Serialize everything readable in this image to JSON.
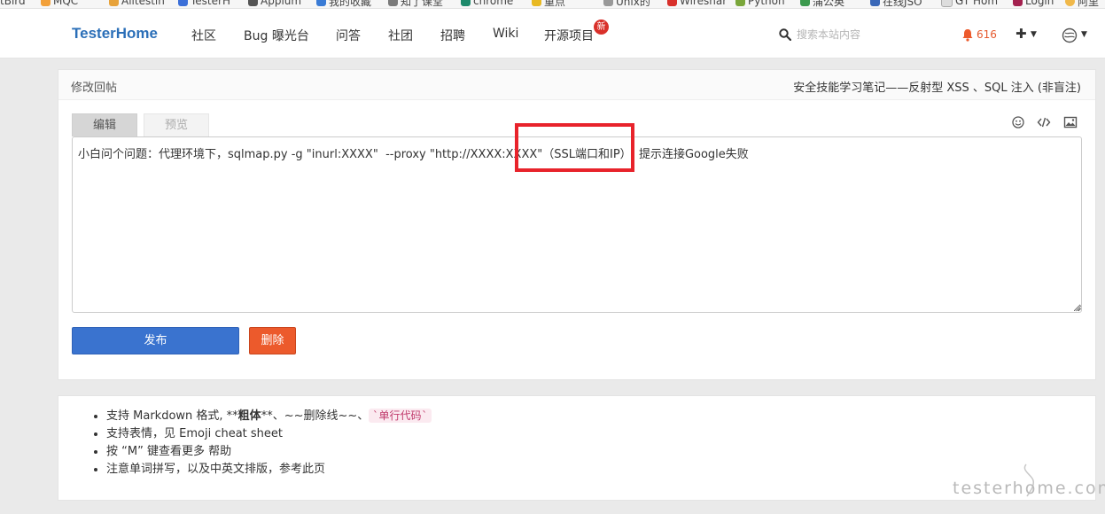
{
  "bookmarks": [
    "tBird",
    "MQC",
    "Alitestin",
    "TesterH",
    "Appium",
    "我的收藏",
    "知了课堂",
    "chrome",
    "重点",
    "Unix的",
    "Wireshar",
    "Python",
    "蒲公英",
    "在线JSO",
    "GT Hom",
    "Login",
    "阿里"
  ],
  "navbar": {
    "brand": "TesterHome",
    "items": [
      "社区",
      "Bug 曝光台",
      "问答",
      "社团",
      "招聘",
      "Wiki",
      "开源项目"
    ],
    "new_badge": "新",
    "search_placeholder": "搜索本站内容",
    "notification_count": "616"
  },
  "panel": {
    "title": "修改回帖",
    "topic_title": "安全技能学习笔记——反射型 XSS 、SQL 注入 (非盲注)",
    "tabs": [
      "编辑",
      "预览"
    ],
    "editor_text": "小白问个问题：代理环境下，sqlmap.py -g \"inurl:XXXX\"  --proxy \"http://XXXX:XXXX\"（SSL端口和IP）  提示连接Google失败",
    "publish_label": "发布",
    "delete_label": "删除"
  },
  "help": {
    "items": [
      {
        "before": "支持 Markdown 格式, **",
        "bold": "粗体",
        "after": "**、~~删除线~~、",
        "code": "`单行代码`"
      },
      {
        "text": "支持表情，见 Emoji cheat sheet"
      },
      {
        "text": "按 “M” 键查看更多 帮助"
      },
      {
        "text": "注意单词拼写，以及中英文排版，参考此页"
      }
    ]
  },
  "watermark": "testerhome.com",
  "colors": {
    "brand": "#2b6fb8",
    "publish": "#3a73cf",
    "delete": "#ec5a2c",
    "highlight": "#e8232b"
  }
}
